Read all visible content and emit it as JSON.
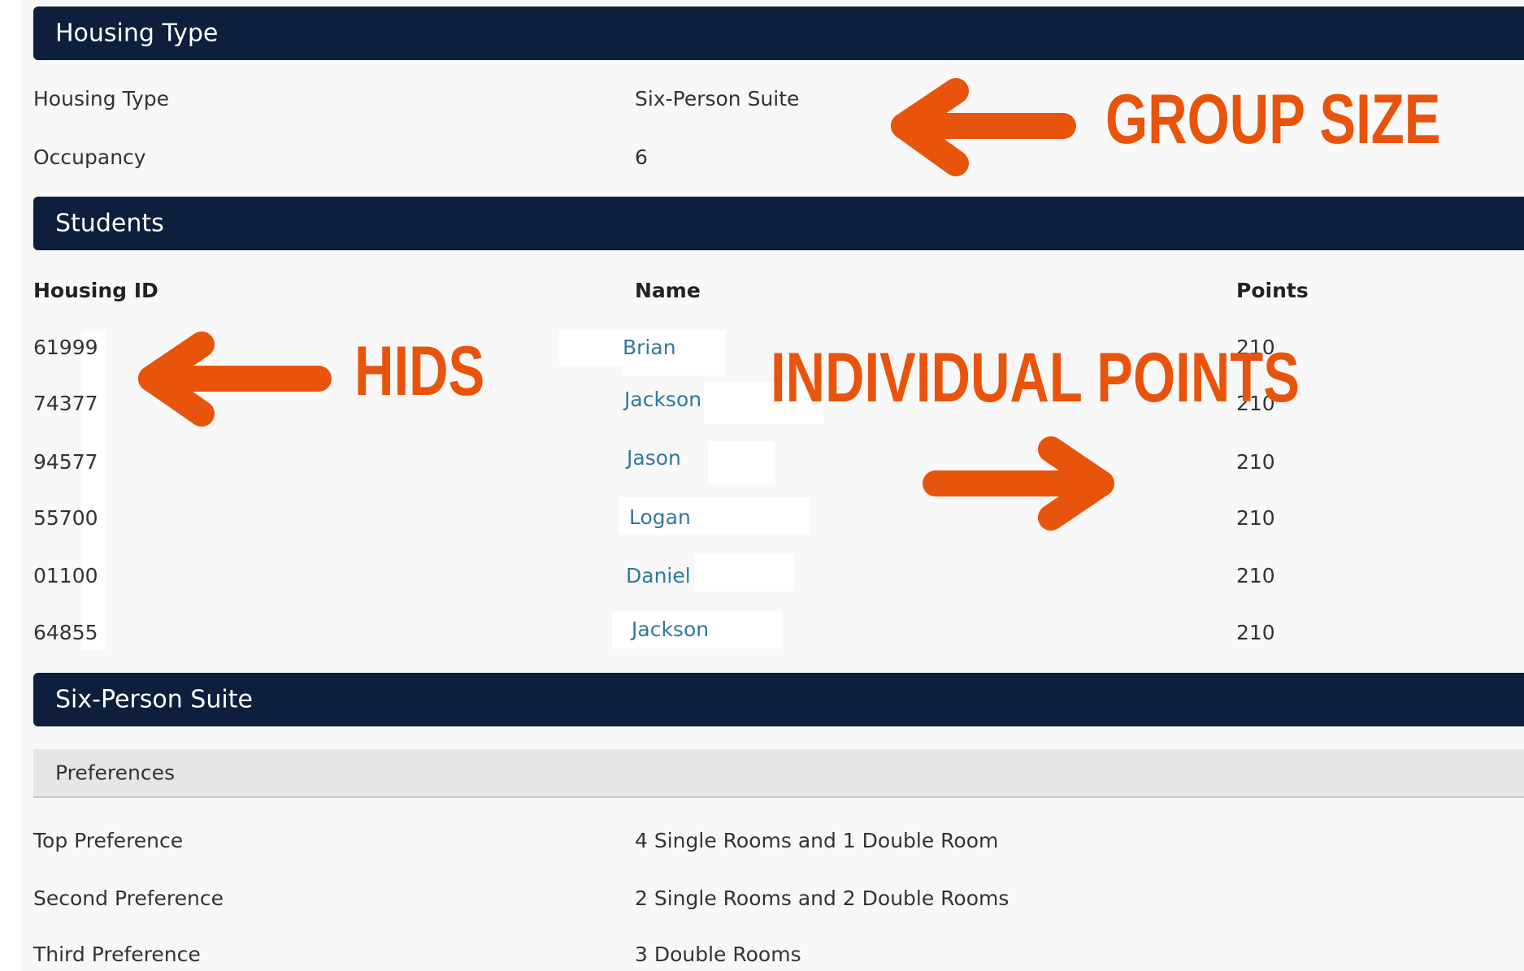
{
  "housing_type_section": {
    "header": "Housing Type",
    "rows": [
      {
        "label": "Housing Type",
        "value": "Six-Person Suite"
      },
      {
        "label": "Occupancy",
        "value": "6"
      }
    ]
  },
  "students_section": {
    "header": "Students",
    "columns": [
      "Housing ID",
      "Name",
      "Points"
    ],
    "rows": [
      {
        "housing_id": "61999",
        "name": "Brian",
        "points": "210"
      },
      {
        "housing_id": "74377",
        "name": "Jackson",
        "points": "210"
      },
      {
        "housing_id": "94577",
        "name": "Jason",
        "points": "210"
      },
      {
        "housing_id": "55700",
        "name": "Logan",
        "points": "210"
      },
      {
        "housing_id": "01100",
        "name": "Daniel",
        "points": "210"
      },
      {
        "housing_id": "64855",
        "name": "Jackson",
        "points": "210"
      }
    ]
  },
  "suite_section": {
    "header": "Six-Person Suite",
    "subheader": "Preferences",
    "rows": [
      {
        "label": "Top Preference",
        "value": "4 Single Rooms and 1 Double Room"
      },
      {
        "label": "Second Preference",
        "value": "2 Single Rooms and 2 Double Rooms"
      },
      {
        "label": "Third Preference",
        "value": "3 Double Rooms"
      }
    ]
  },
  "annotations": {
    "group_size": "GROUP SIZE",
    "hids": "HIDS",
    "individual_points": "INDIVIDUAL POINTS",
    "color": "#e8540c"
  },
  "colors": {
    "header_bg": "#0d1f3d",
    "link": "#2f7a9c",
    "page_bg": "#f8f8f8"
  }
}
